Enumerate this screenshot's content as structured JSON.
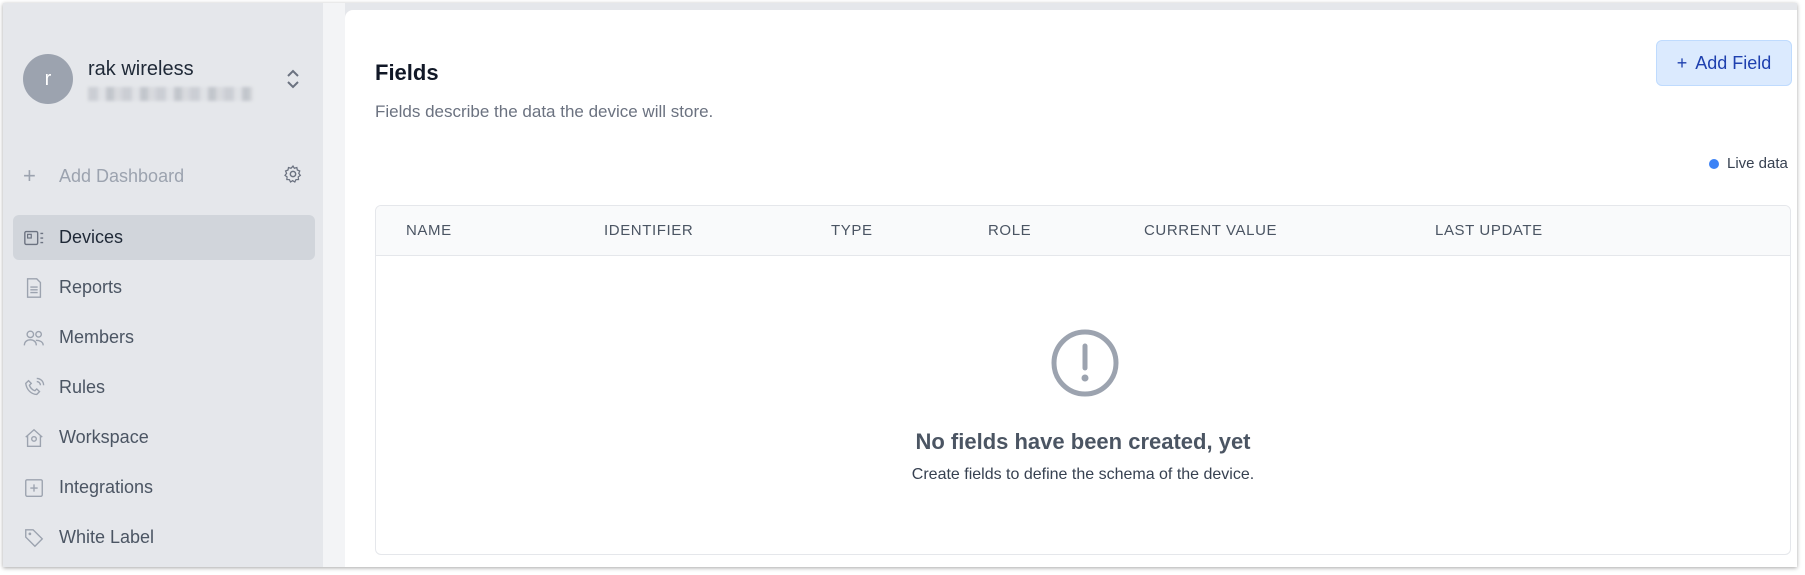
{
  "account": {
    "initial": "r",
    "name": "rak wireless"
  },
  "sidebar": {
    "add_dashboard": "Add Dashboard",
    "items": [
      {
        "label": "Devices",
        "icon": "devices-icon",
        "active": true
      },
      {
        "label": "Reports",
        "icon": "reports-icon"
      },
      {
        "label": "Members",
        "icon": "members-icon"
      },
      {
        "label": "Rules",
        "icon": "rules-icon"
      },
      {
        "label": "Workspace",
        "icon": "workspace-icon"
      },
      {
        "label": "Integrations",
        "icon": "integrations-icon"
      },
      {
        "label": "White Label",
        "icon": "tag-icon"
      }
    ]
  },
  "main": {
    "title": "Fields",
    "subtitle": "Fields describe the data the device will store.",
    "add_button": "Add Field",
    "live_label": "Live data",
    "columns": [
      "NAME",
      "IDENTIFIER",
      "TYPE",
      "ROLE",
      "CURRENT VALUE",
      "LAST UPDATE"
    ],
    "empty_title": "No fields have been created, yet",
    "empty_subtitle": "Create fields to define the schema of the device."
  },
  "colors": {
    "accent": "#3b82f6",
    "button_bg": "#dbeafe",
    "sidebar_bg": "#e5e7eb"
  }
}
